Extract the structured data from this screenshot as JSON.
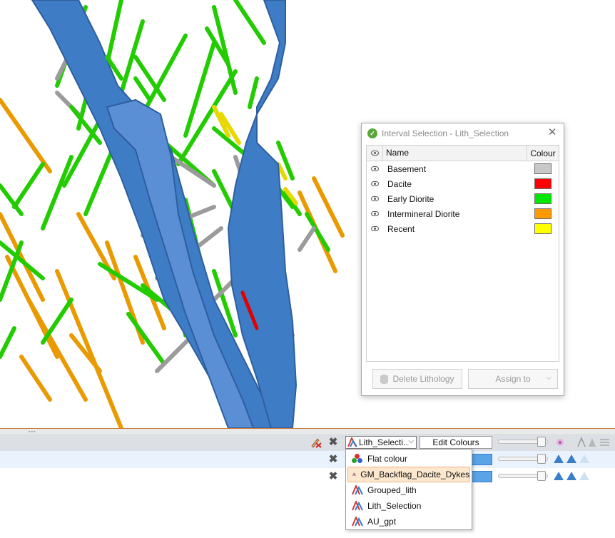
{
  "dialog": {
    "title": "Interval Selection - Lith_Selection",
    "columns": {
      "name": "Name",
      "colour": "Colour"
    },
    "rows": [
      {
        "name": "Basement",
        "colour": "#c8c8c8"
      },
      {
        "name": "Dacite",
        "colour": "#ff0000"
      },
      {
        "name": "Early Diorite",
        "colour": "#00e600"
      },
      {
        "name": "Intermineral Diorite",
        "colour": "#ff9900"
      },
      {
        "name": "Recent",
        "colour": "#ffff00"
      }
    ],
    "buttons": {
      "delete": "Delete Lithology",
      "assign": "Assign to"
    }
  },
  "toolbar": {
    "combo_value": "Lith_Selecti...",
    "edit_colours": "Edit Colours"
  },
  "dropdown": {
    "options": [
      {
        "label": "Flat colour",
        "icon": "flat-colour-icon"
      },
      {
        "label": "GM_Backflag_Dacite_Dykes",
        "icon": "colourmap-icon",
        "selected": true
      },
      {
        "label": "Grouped_lith",
        "icon": "colourmap-icon"
      },
      {
        "label": "Lith_Selection",
        "icon": "colourmap-icon"
      },
      {
        "label": "AU_gpt",
        "icon": "colourmap-icon"
      }
    ]
  },
  "colors": {
    "surface_blue": "#3f7cc6",
    "accent_orange": "#d07a3a",
    "drill_green": "#22cc00",
    "drill_orange": "#e89a00",
    "drill_grey": "#9b9b9b"
  }
}
